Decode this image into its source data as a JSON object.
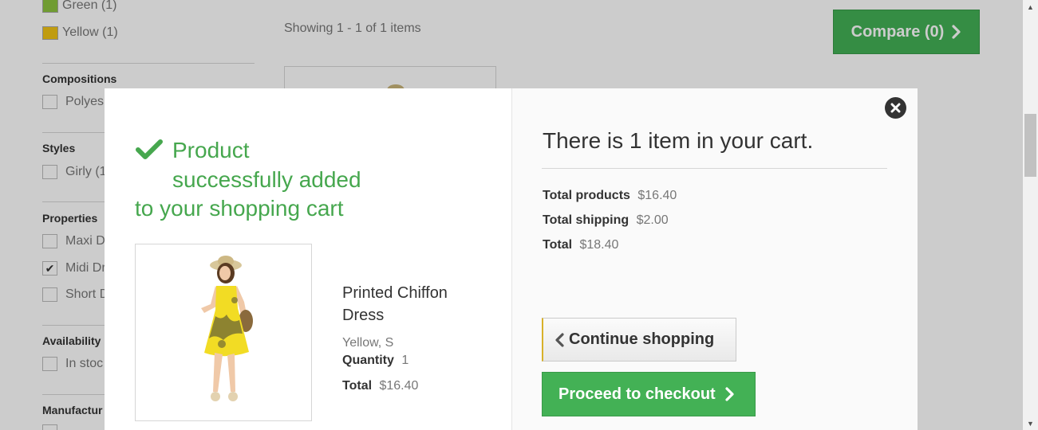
{
  "sidebar": {
    "colors": [
      {
        "label": "Green (1)",
        "color": "#8dc43f"
      },
      {
        "label": "Yellow (1)",
        "color": "#f0c314"
      }
    ],
    "sections": [
      {
        "title": "Compositions",
        "items": [
          {
            "label": "Polyes",
            "checked": false
          }
        ]
      },
      {
        "title": "Styles",
        "items": [
          {
            "label": "Girly (1",
            "checked": false
          }
        ]
      },
      {
        "title": "Properties",
        "items": [
          {
            "label": "Maxi D",
            "checked": false
          },
          {
            "label": "Midi Dr",
            "checked": true
          },
          {
            "label": "Short D",
            "checked": false
          }
        ]
      },
      {
        "title": "Availability",
        "items": [
          {
            "label": "In stoc",
            "checked": false
          }
        ]
      },
      {
        "title": "Manufactur",
        "items": []
      }
    ]
  },
  "listing": {
    "showing": "Showing 1 - 1 of 1 items",
    "compare_label": "Compare (0)"
  },
  "modal": {
    "success": {
      "line1": "Product",
      "line2": "successfully added",
      "line3": "to your shopping cart"
    },
    "product": {
      "name": "Printed Chiffon Dress",
      "attributes": "Yellow, S",
      "quantity_label": "Quantity",
      "quantity": "1",
      "total_label": "Total",
      "total": "$16.40"
    },
    "cart": {
      "heading": "There is 1 item in your cart.",
      "total_products_label": "Total products",
      "total_products": "$16.40",
      "total_shipping_label": "Total shipping",
      "total_shipping": "$2.00",
      "total_label": "Total",
      "total": "$18.40"
    },
    "buttons": {
      "continue": "Continue shopping",
      "checkout": "Proceed to checkout"
    }
  },
  "colors": {
    "accent_green": "#43b155",
    "success_text": "#46a74e",
    "continue_border": "#d8b12a"
  },
  "icons": [
    "check-icon",
    "chevron-left-icon",
    "chevron-right-icon",
    "close-icon"
  ]
}
